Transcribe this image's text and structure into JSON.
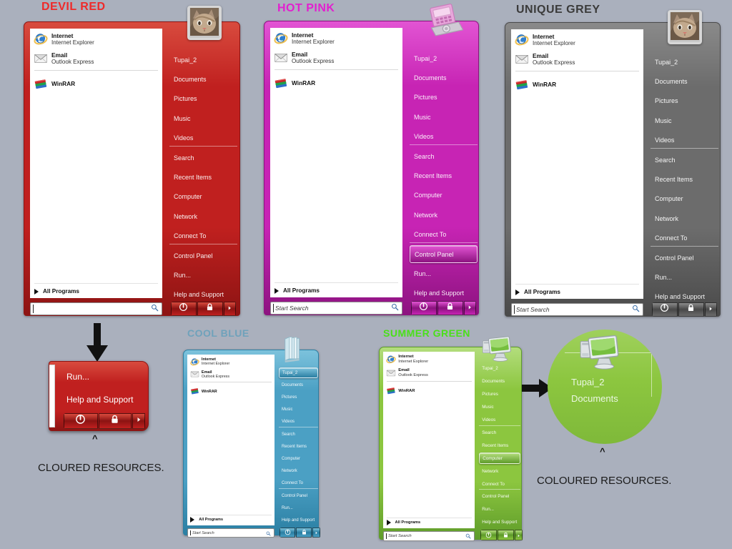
{
  "background_color": "#aab0bd",
  "menus": [
    {
      "id": "devil-red",
      "title": "DEVIL RED",
      "title_color": "#ef2a2a",
      "accent": "#c0201f",
      "accent_dark": "#8d1413",
      "accent_light": "#d84b3e",
      "avatar_icon": "cat-photo-icon",
      "programs": [
        {
          "name": "Internet",
          "sub": "Internet Explorer",
          "icon": "internet-explorer-icon"
        },
        {
          "name": "Email",
          "sub": "Outlook Express",
          "icon": "outlook-express-icon"
        },
        {
          "name": "WinRAR",
          "sub": "",
          "icon": "winrar-icon"
        }
      ],
      "all_programs": "All Programs",
      "right_items": [
        "Tupai_2",
        "Documents",
        "Pictures",
        "Music",
        "Videos",
        "Search",
        "Recent Items",
        "Computer",
        "Network",
        "Connect To",
        "Control Panel",
        "Run...",
        "Help and Support"
      ],
      "selected_item": null,
      "search_placeholder": "",
      "search_value": "",
      "power_buttons": [
        "power-icon",
        "lock-icon",
        "arrow-right-icon"
      ]
    },
    {
      "id": "hot-pink",
      "title": "HOT PINK",
      "title_color": "#e220cf",
      "accent": "#c724b4",
      "accent_dark": "#8d1380",
      "accent_light": "#e254d3",
      "avatar_icon": "pink-device-icon",
      "programs": [
        {
          "name": "Internet",
          "sub": "Internet Explorer",
          "icon": "internet-explorer-icon"
        },
        {
          "name": "Email",
          "sub": "Outlook Express",
          "icon": "outlook-express-icon"
        },
        {
          "name": "WinRAR",
          "sub": "",
          "icon": "winrar-icon"
        }
      ],
      "all_programs": "All Programs",
      "right_items": [
        "Tupai_2",
        "Documents",
        "Pictures",
        "Music",
        "Videos",
        "Search",
        "Recent Items",
        "Computer",
        "Network",
        "Connect To",
        "Control Panel",
        "Run...",
        "Help and Support"
      ],
      "selected_item": "Control Panel",
      "search_placeholder": "Start Search",
      "search_value": "",
      "power_buttons": [
        "power-icon",
        "lock-icon",
        "arrow-right-icon"
      ]
    },
    {
      "id": "unique-grey",
      "title": "UNIQUE GREY",
      "title_color": "#3b3b3b",
      "accent": "#6c6c6c",
      "accent_dark": "#4a4a4a",
      "accent_light": "#8a8a8a",
      "avatar_icon": "cat-photo-icon",
      "programs": [
        {
          "name": "Internet",
          "sub": "Internet Explorer",
          "icon": "internet-explorer-icon"
        },
        {
          "name": "Email",
          "sub": "Outlook Express",
          "icon": "outlook-express-icon"
        },
        {
          "name": "WinRAR",
          "sub": "",
          "icon": "winrar-icon"
        }
      ],
      "all_programs": "All Programs",
      "right_items": [
        "Tupai_2",
        "Documents",
        "Pictures",
        "Music",
        "Videos",
        "Search",
        "Recent Items",
        "Computer",
        "Network",
        "Connect To",
        "Control Panel",
        "Run...",
        "Help and Support"
      ],
      "selected_item": null,
      "search_placeholder": "Start Search",
      "search_value": "",
      "power_buttons": [
        "power-icon",
        "lock-icon",
        "arrow-right-icon"
      ]
    },
    {
      "id": "cool-blue",
      "title": "COOL BLUE",
      "title_color": "#6fa2bb",
      "accent": "#4ba0c4",
      "accent_dark": "#2b7fa3",
      "accent_light": "#7cc2dc",
      "avatar_icon": "blue-books-icon",
      "programs": [
        {
          "name": "Internet",
          "sub": "Internet Explorer",
          "icon": "internet-explorer-icon"
        },
        {
          "name": "Email",
          "sub": "Outlook Express",
          "icon": "outlook-express-icon"
        },
        {
          "name": "WinRAR",
          "sub": "",
          "icon": "winrar-icon"
        }
      ],
      "all_programs": "All Programs",
      "right_items": [
        "Tupai_2",
        "Documents",
        "Pictures",
        "Music",
        "Videos",
        "Search",
        "Recent Items",
        "Computer",
        "Network",
        "Connect To",
        "Control Panel",
        "Run...",
        "Help and Support"
      ],
      "selected_item": "Tupai_2",
      "search_placeholder": "Start Search",
      "search_value": "",
      "power_buttons": [
        "power-icon",
        "lock-icon",
        "arrow-right-icon"
      ]
    },
    {
      "id": "summer-green",
      "title": "SUMMER GREEN",
      "title_color": "#4ae019",
      "accent": "#8cc63f",
      "accent_dark": "#5f9c2a",
      "accent_light": "#b3dd7d",
      "avatar_icon": "green-monitor-icon",
      "programs": [
        {
          "name": "Internet",
          "sub": "Internet Explorer",
          "icon": "internet-explorer-icon"
        },
        {
          "name": "Email",
          "sub": "Outlook Express",
          "icon": "outlook-express-icon"
        },
        {
          "name": "WinRAR",
          "sub": "",
          "icon": "winrar-icon"
        }
      ],
      "all_programs": "All Programs",
      "right_items": [
        "Tupai_2",
        "Documents",
        "Pictures",
        "Music",
        "Videos",
        "Search",
        "Recent Items",
        "Computer",
        "Network",
        "Connect To",
        "Control Panel",
        "Run...",
        "Help and Support"
      ],
      "selected_item": "Computer",
      "search_placeholder": "Start Search",
      "search_value": "",
      "power_buttons": [
        "power-icon",
        "lock-icon",
        "arrow-right-icon"
      ]
    }
  ],
  "callouts": {
    "red_zoom": {
      "items": [
        "Run...",
        "Help and Support"
      ],
      "power_buttons": [
        "power-icon",
        "lock-icon",
        "arrow-right-icon"
      ],
      "caret": "^",
      "caption": "CLOURED RESOURCES."
    },
    "green_zoom": {
      "items": [
        "Tupai_2",
        "Documents"
      ],
      "caret": "^",
      "caption": "COLOURED RESOURCES.",
      "icon": "green-monitor-icon"
    }
  }
}
